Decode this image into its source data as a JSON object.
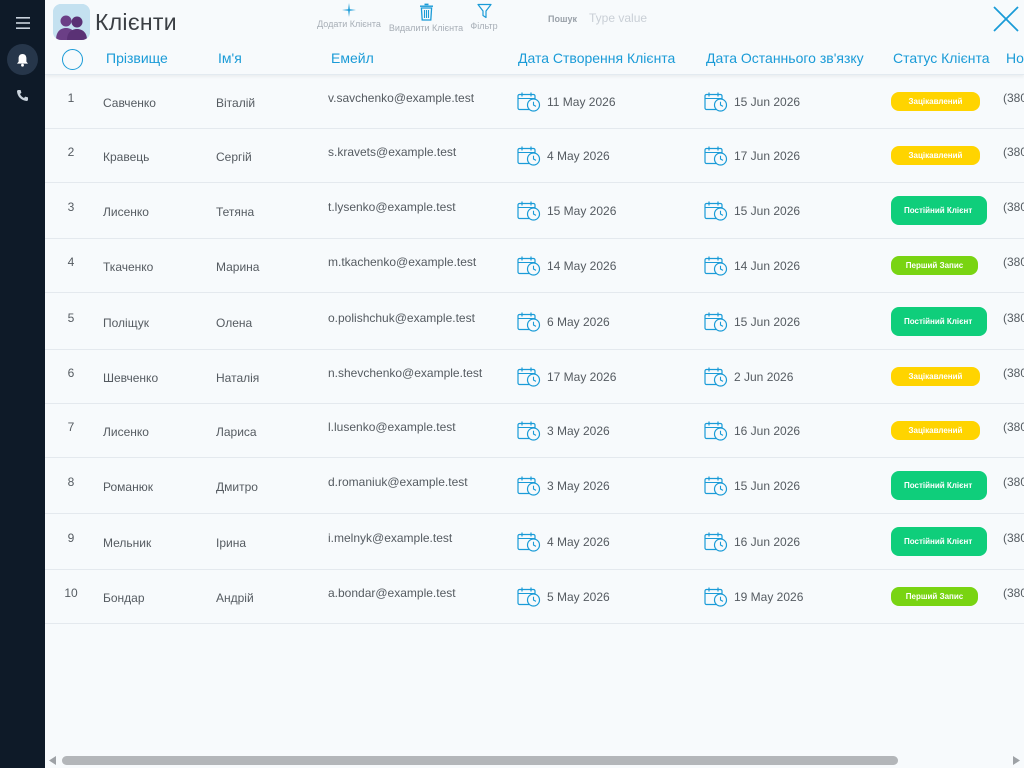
{
  "header": {
    "title": "Клієнти",
    "toolbar": {
      "add_label": "Додати Клієнта",
      "delete_label": "Видалити Клієнта",
      "filter_label": "Фільтр"
    },
    "search": {
      "label": "Пошук",
      "placeholder": "Type value",
      "value": ""
    }
  },
  "table": {
    "columns": [
      "Прізвище",
      "Ім'я",
      "Емейл",
      "Дата Створення Клієнта",
      "Дата Останнього зв'язку",
      "Статус Клієнта",
      "Но"
    ],
    "phone_prefix": "(380",
    "rows": [
      {
        "num": "1",
        "surname": "Савченко",
        "name": "Віталій",
        "email": "v.savchenko@example.test",
        "created": "11 May 2026",
        "last": "15 Jun 2026",
        "status": "Зацікавлений",
        "status_kind": "yellow"
      },
      {
        "num": "2",
        "surname": "Кравець",
        "name": "Сергій",
        "email": "s.kravets@example.test",
        "created": "4 May 2026",
        "last": "17 Jun 2026",
        "status": "Зацікавлений",
        "status_kind": "yellow"
      },
      {
        "num": "3",
        "surname": "Лисенко",
        "name": "Тетяна",
        "email": "t.lysenko@example.test",
        "created": "15 May 2026",
        "last": "15 Jun 2026",
        "status": "Постійний Клієнт",
        "status_kind": "green"
      },
      {
        "num": "4",
        "surname": "Ткаченко",
        "name": "Марина",
        "email": "m.tkachenko@example.test",
        "created": "14 May 2026",
        "last": "14 Jun 2026",
        "status": "Перший Запис",
        "status_kind": "lime"
      },
      {
        "num": "5",
        "surname": "Поліщук",
        "name": "Олена",
        "email": "o.polishchuk@example.test",
        "created": "6 May 2026",
        "last": "15 Jun 2026",
        "status": "Постійний Клієнт",
        "status_kind": "green"
      },
      {
        "num": "6",
        "surname": "Шевченко",
        "name": "Наталія",
        "email": "n.shevchenko@example.test",
        "created": "17 May 2026",
        "last": "2 Jun 2026",
        "status": "Зацікавлений",
        "status_kind": "yellow"
      },
      {
        "num": "7",
        "surname": "Лисенко",
        "name": "Лариса",
        "email": "l.lusenko@example.test",
        "created": "3 May 2026",
        "last": "16 Jun 2026",
        "status": "Зацікавлений",
        "status_kind": "yellow"
      },
      {
        "num": "8",
        "surname": "Романюк",
        "name": "Дмитро",
        "email": "d.romaniuk@example.test",
        "created": "3 May 2026",
        "last": "15 Jun 2026",
        "status": "Постійний Клієнт",
        "status_kind": "green"
      },
      {
        "num": "9",
        "surname": "Мельник",
        "name": "Ірина",
        "email": "i.melnyk@example.test",
        "created": "4 May 2026",
        "last": "16 Jun 2026",
        "status": "Постійний Клієнт",
        "status_kind": "green"
      },
      {
        "num": "10",
        "surname": "Бондар",
        "name": "Андрій",
        "email": "a.bondar@example.test",
        "created": "5 May 2026",
        "last": "19 May 2026",
        "status": "Перший Запис",
        "status_kind": "lime"
      }
    ]
  },
  "colors": {
    "accent": "#1a9bd7",
    "sidebar": "#0e1a28",
    "status_yellow": "#ffd400",
    "status_green": "#0fce7b",
    "status_lime": "#79d412"
  },
  "icons": {
    "sidebar": [
      "menu-icon",
      "bell-icon",
      "phone-icon"
    ],
    "toolbar": [
      "plus-sparkle-icon",
      "trash-icon",
      "filter-icon"
    ],
    "date": "calendar-clock-icon",
    "close": "close-icon"
  }
}
